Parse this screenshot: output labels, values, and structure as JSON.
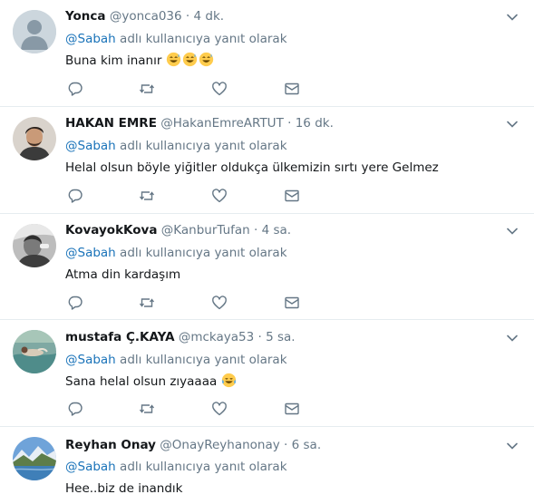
{
  "tweets": [
    {
      "name": "Yonca",
      "handle": "@yonca036",
      "separator": "·",
      "time": "4 dk.",
      "reply_mention": "@Sabah",
      "reply_rest": " adlı kullanıcıya yanıt olarak",
      "text": "Buna kim inanır",
      "emojis": [
        "grinning-sweat",
        "grinning-sweat",
        "grinning-sweat"
      ],
      "avatar": "default-profile"
    },
    {
      "name": "HAKAN EMRE",
      "handle": "@HakanEmreARTUT",
      "separator": "·",
      "time": "16 dk.",
      "reply_mention": "@Sabah",
      "reply_rest": " adlı kullanıcıya yanıt olarak",
      "text": "Helal olsun böyle yiğitler oldukça ülkemizin sırtı yere Gelmez",
      "emojis": [],
      "avatar": "man-photo"
    },
    {
      "name": "KovayokKova",
      "handle": "@KanburTufan",
      "separator": "·",
      "time": "4 sa.",
      "reply_mention": "@Sabah",
      "reply_rest": " adlı kullanıcıya yanıt olarak",
      "text": "Atma din kardaşım",
      "emojis": [],
      "avatar": "bw-photo"
    },
    {
      "name": "mustafa Ç.KAYA",
      "handle": "@mckaya53",
      "separator": "·",
      "time": "5 sa.",
      "reply_mention": "@Sabah",
      "reply_rest": " adlı kullanıcıya yanıt olarak",
      "text": "Sana helal olsun zıyaaaa",
      "emojis": [
        "tears-of-joy"
      ],
      "avatar": "water-photo"
    },
    {
      "name": "Reyhan Onay",
      "handle": "@OnayReyhanonay",
      "separator": "·",
      "time": "6 sa.",
      "reply_mention": "@Sabah",
      "reply_rest": " adlı kullanıcıya yanıt olarak",
      "text": "Hee..biz de inandık",
      "emojis": [],
      "avatar": "mountain-photo"
    }
  ],
  "icons": {
    "reply": "reply-icon",
    "retweet": "retweet-icon",
    "like": "heart-icon",
    "dm": "envelope-icon",
    "more": "chevron-down-icon"
  },
  "colors": {
    "text": "#14171a",
    "muted": "#657786",
    "divider": "#e6ecf0",
    "mention": "#1a73b9"
  }
}
